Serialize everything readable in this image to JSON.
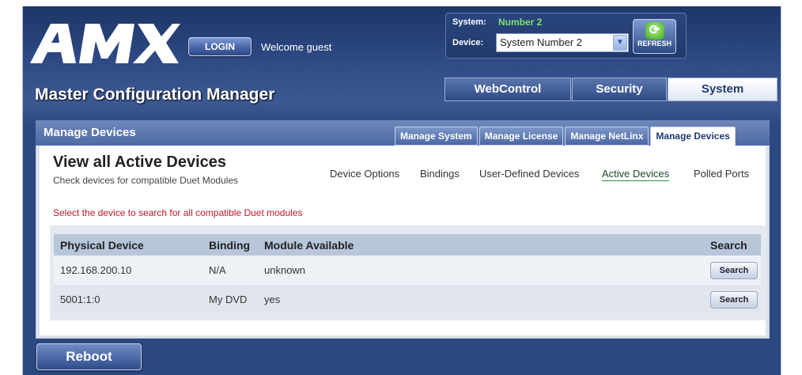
{
  "header": {
    "logo_text": "AMX",
    "login_label": "LOGIN",
    "welcome": "Welcome guest",
    "app_title": "Master Configuration Manager",
    "system_label": "System:",
    "system_value": "Number 2",
    "device_label": "Device:",
    "device_select_value": "System Number 2",
    "refresh_label": "REFRESH",
    "top_tabs": [
      {
        "label": "WebControl",
        "active": false
      },
      {
        "label": "Security",
        "active": false
      },
      {
        "label": "System",
        "active": true
      }
    ]
  },
  "panel": {
    "title": "Manage Devices",
    "sub_tabs": [
      {
        "label": "Manage System",
        "active": false
      },
      {
        "label": "Manage License",
        "active": false
      },
      {
        "label": "Manage NetLinx",
        "active": false
      },
      {
        "label": "Manage Devices",
        "active": true
      }
    ]
  },
  "view": {
    "title": "View all Active Devices",
    "subtitle": "Check devices for compatible Duet Modules",
    "nav": [
      {
        "label": "Device Options",
        "active": false
      },
      {
        "label": "Bindings",
        "active": false
      },
      {
        "label": "User-Defined Devices",
        "active": false
      },
      {
        "label": "Active Devices",
        "active": true
      },
      {
        "label": "Polled Ports",
        "active": false
      }
    ],
    "hint": "Select the device to search for all compatible Duet modules"
  },
  "table": {
    "headers": [
      "Physical Device",
      "Binding",
      "Module Available",
      "Search"
    ],
    "rows": [
      {
        "device": "192.168.200.10",
        "binding": "N/A",
        "module": "unknown",
        "action": "Search"
      },
      {
        "device": "5001:1:0",
        "binding": "My DVD",
        "module": "yes",
        "action": "Search"
      }
    ]
  },
  "footer": {
    "reboot_label": "Reboot"
  },
  "colors": {
    "header_bg": "#2f4a85",
    "accent_green": "#7ee06e",
    "hint_red": "#c0182a",
    "table_header": "#b8c6da"
  }
}
